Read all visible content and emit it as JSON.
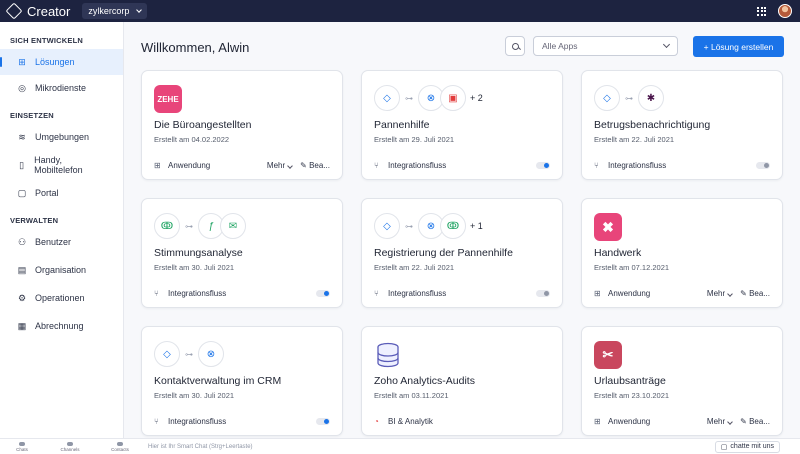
{
  "topbar": {
    "app_name": "Creator",
    "org": "zylkercorp"
  },
  "sidebar": {
    "sections": [
      {
        "title": "SICH ENTWICKELN",
        "items": [
          {
            "label": "Lösungen",
            "icon": "apps-icon",
            "active": true
          },
          {
            "label": "Mikrodienste",
            "icon": "microservices-icon",
            "active": false
          }
        ]
      },
      {
        "title": "EINSETZEN",
        "items": [
          {
            "label": "Umgebungen",
            "icon": "layers-icon",
            "active": false
          },
          {
            "label": "Handy, Mobiltelefon",
            "icon": "phone-icon",
            "active": false
          },
          {
            "label": "Portal",
            "icon": "portal-icon",
            "active": false
          }
        ]
      },
      {
        "title": "VERWALTEN",
        "items": [
          {
            "label": "Benutzer",
            "icon": "users-icon",
            "active": false
          },
          {
            "label": "Organisation",
            "icon": "building-icon",
            "active": false
          },
          {
            "label": "Operationen",
            "icon": "gear-icon",
            "active": false
          },
          {
            "label": "Abrechnung",
            "icon": "billing-icon",
            "active": false
          }
        ]
      }
    ]
  },
  "main": {
    "title": "Willkommen, Alwin",
    "filter": "Alle Apps",
    "create_button": "+ Lösung erstellen"
  },
  "cards": [
    {
      "title": "Die Büroangestellten",
      "date": "Erstellt am 04.02.2022",
      "type": "Anwendung",
      "kind": "app",
      "tile_text": "ZEHE",
      "tile_color": "#e8457a",
      "more": "Mehr",
      "edit": "Bea..."
    },
    {
      "title": "Pannenhilfe",
      "date": "Erstellt am 29. Juli 2021",
      "type": "Integrationsfluss",
      "kind": "flow",
      "extra": "+ 2",
      "toggle": "on"
    },
    {
      "title": "Betrugsbenachrichtigung",
      "date": "Erstellt am 22. Juli 2021",
      "type": "Integrationsfluss",
      "kind": "flow",
      "extra": "",
      "toggle": "off"
    },
    {
      "title": "Stimmungsanalyse",
      "date": "Erstellt am 30. Juli 2021",
      "type": "Integrationsfluss",
      "kind": "flow",
      "extra": "",
      "toggle": "on"
    },
    {
      "title": "Registrierung der Pannenhilfe",
      "date": "Erstellt am 22. Juli 2021",
      "type": "Integrationsfluss",
      "kind": "flow",
      "extra": "+ 1",
      "toggle": "off"
    },
    {
      "title": "Handwerk",
      "date": "Erstellt am 07.12.2021",
      "type": "Anwendung",
      "kind": "app",
      "tile_text": "✖",
      "tile_color": "#e8457a",
      "more": "Mehr",
      "edit": "Bea..."
    },
    {
      "title": "Kontaktverwaltung im CRM",
      "date": "Erstellt am 30. Juli 2021",
      "type": "Integrationsfluss",
      "kind": "flow",
      "extra": "",
      "toggle": "on"
    },
    {
      "title": "Zoho Analytics-Audits",
      "date": "Erstellt am 03.11.2021",
      "type": "BI & Analytik",
      "kind": "analytics"
    },
    {
      "title": "Urlaubsanträge",
      "date": "Erstellt am 23.10.2021",
      "type": "Anwendung",
      "kind": "app",
      "tile_text": "✂",
      "tile_color": "#c9475e",
      "more": "Mehr",
      "edit": "Bea..."
    }
  ],
  "bottombar": {
    "items": [
      "Chats",
      "Channels",
      "Contacts"
    ],
    "chat_placeholder": "Hier ist Ihr Smart Chat (Strg+Leertaste)",
    "chat_button": "chatte mit uns"
  }
}
